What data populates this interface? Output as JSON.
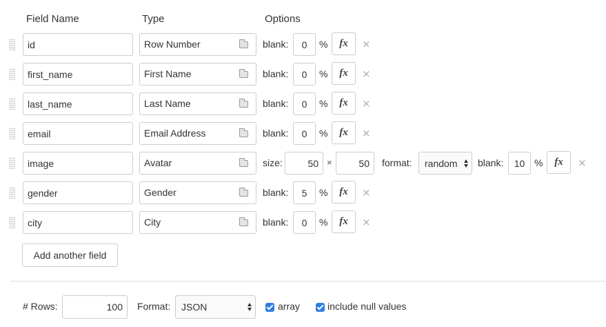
{
  "headers": {
    "field_name": "Field Name",
    "type": "Type",
    "options": "Options"
  },
  "labels": {
    "blank": "blank:",
    "percent": "%",
    "size": "size:",
    "times": "×",
    "format": "format:"
  },
  "fx_label": "fx",
  "remove_glyph": "×",
  "fields": [
    {
      "name": "id",
      "type": "Row Number",
      "blank": "0"
    },
    {
      "name": "first_name",
      "type": "First Name",
      "blank": "0"
    },
    {
      "name": "last_name",
      "type": "Last Name",
      "blank": "0"
    },
    {
      "name": "email",
      "type": "Email Address",
      "blank": "0"
    },
    {
      "name": "image",
      "type": "Avatar",
      "size_w": "50",
      "size_h": "50",
      "format": "random",
      "blank": "10"
    },
    {
      "name": "gender",
      "type": "Gender",
      "blank": "5"
    },
    {
      "name": "city",
      "type": "City",
      "blank": "0"
    }
  ],
  "add_field_label": "Add another field",
  "footer": {
    "rows_label": "# Rows:",
    "rows_value": "100",
    "format_label": "Format:",
    "format_value": "JSON",
    "array_label": "array",
    "array_checked": true,
    "null_label": "include null values",
    "null_checked": true
  },
  "colors": {
    "checkbox": "#2f7ee0",
    "border": "#cccccc"
  }
}
